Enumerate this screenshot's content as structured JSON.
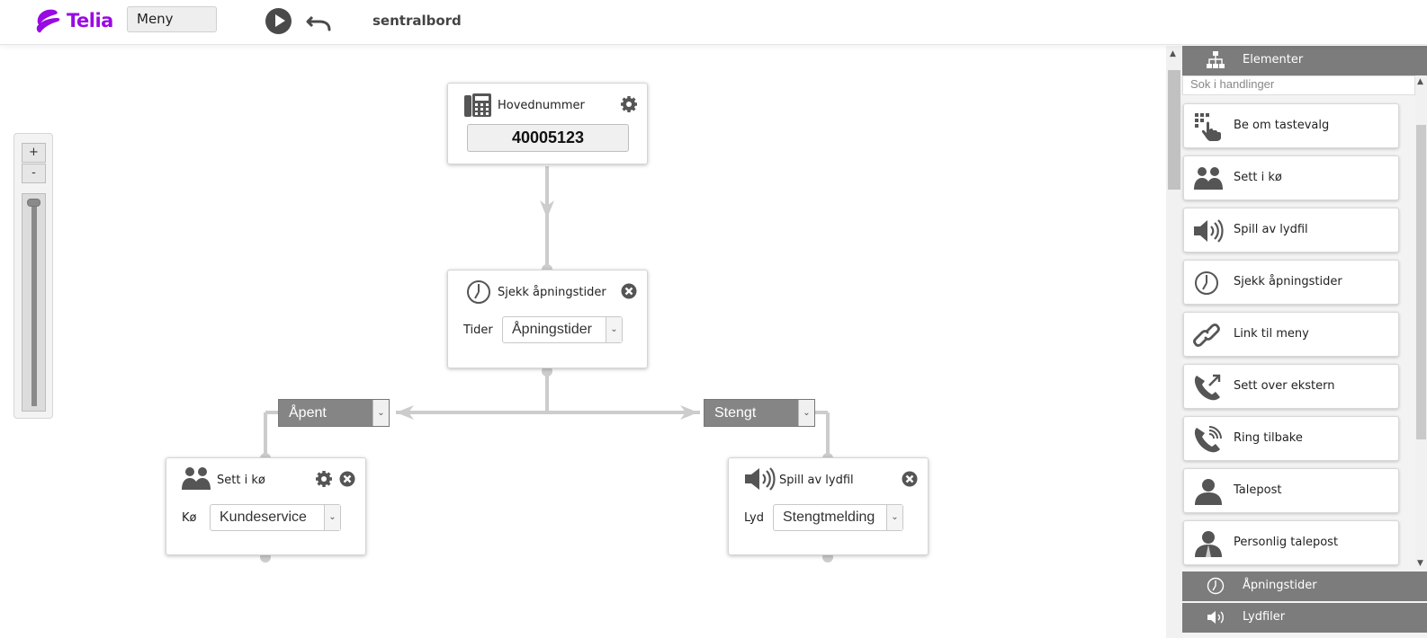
{
  "header": {
    "logo_text": "Telia",
    "menu_label": "Meny",
    "title": "sentralbord"
  },
  "zoom": {
    "plus": "+",
    "minus": "-",
    "level": 1.0
  },
  "nodes": {
    "main_number": {
      "title": "Hovednummer",
      "number": "40005123"
    },
    "opening_check": {
      "title": "Sjekk åpningstider",
      "field_label": "Tider",
      "value": "Åpningstider"
    },
    "queue": {
      "title": "Sett i kø",
      "field_label": "Kø",
      "value": "Kundeservice"
    },
    "sound": {
      "title": "Spill av lydfil",
      "field_label": "Lyd",
      "value": "Stengtmelding"
    }
  },
  "branches": {
    "open": "Åpent",
    "closed": "Stengt"
  },
  "panel": {
    "header": "Elementer",
    "search_placeholder": "Sok i handlinger",
    "actions": [
      {
        "label": "Be om tastevalg",
        "icon": "keypad-touch-icon"
      },
      {
        "label": "Sett i kø",
        "icon": "queue-users-icon"
      },
      {
        "label": "Spill av lydfil",
        "icon": "speaker-icon"
      },
      {
        "label": "Sjekk åpningstider",
        "icon": "clock-icon"
      },
      {
        "label": "Link til meny",
        "icon": "link-icon"
      },
      {
        "label": "Sett over ekstern",
        "icon": "phone-forward-icon"
      },
      {
        "label": "Ring tilbake",
        "icon": "phone-callback-icon"
      },
      {
        "label": "Talepost",
        "icon": "voicemail-user-icon"
      },
      {
        "label": "Personlig talepost",
        "icon": "personal-voicemail-icon"
      }
    ],
    "footer_sections": [
      {
        "label": "Åpningstider",
        "icon": "clock-icon"
      },
      {
        "label": "Lydfiler",
        "icon": "speaker-icon"
      }
    ]
  },
  "colors": {
    "brand": "#990ae3",
    "header_gray": "#7c7c7c",
    "connector": "#cccccc"
  }
}
